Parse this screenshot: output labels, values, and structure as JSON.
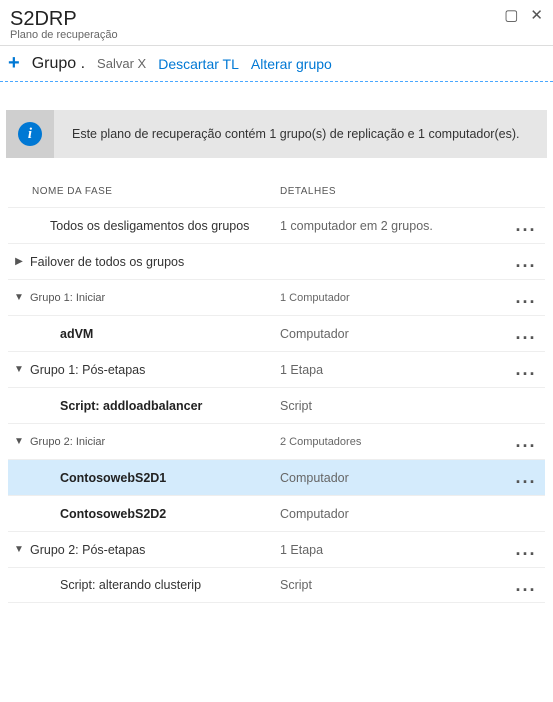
{
  "header": {
    "title": "S2DRP",
    "subtitle": "Plano de recuperação"
  },
  "toolbar": {
    "add_icon": "+",
    "group_label": "Grupo .",
    "save_label": "Salvar",
    "cancel_icon": "X",
    "discard_label": "Descartar TL",
    "change_group_label": "Alterar grupo"
  },
  "infobar": {
    "icon_letter": "i",
    "message": "Este plano de recuperação contém 1 grupo(s) de replicação e 1 computador(es)."
  },
  "columns": {
    "phase": "NOME DA FASE",
    "details": "DETALHES"
  },
  "rows": [
    {
      "arrow": "",
      "indent": "indent1",
      "bold": false,
      "tiny": false,
      "label": "Todos os desligamentos dos grupos",
      "detail": "1 computador em 2 grupos.",
      "dots": true,
      "selected": false
    },
    {
      "arrow": "▶",
      "indent": "",
      "bold": false,
      "tiny": false,
      "label": "Failover de todos os grupos",
      "detail": "",
      "dots": true,
      "selected": false
    },
    {
      "arrow": "▼",
      "indent": "",
      "bold": false,
      "tiny": true,
      "label": "Grupo 1: Iniciar",
      "detail": "1 Computador",
      "dots": true,
      "selected": false
    },
    {
      "arrow": "",
      "indent": "indent2",
      "bold": true,
      "tiny": false,
      "label": "adVM",
      "detail": "Computador",
      "dots": true,
      "selected": false
    },
    {
      "arrow": "▼",
      "indent": "",
      "bold": false,
      "tiny": false,
      "label": "Grupo 1: Pós-etapas",
      "detail": "1 Etapa",
      "dots": true,
      "selected": false
    },
    {
      "arrow": "",
      "indent": "indent2",
      "bold": true,
      "tiny": false,
      "label": "Script: addloadbalancer",
      "detail": "Script",
      "dots": false,
      "selected": false
    },
    {
      "arrow": "▼",
      "indent": "",
      "bold": false,
      "tiny": true,
      "label": "Grupo 2: Iniciar",
      "detail": "2 Computadores",
      "dots": true,
      "selected": false
    },
    {
      "arrow": "",
      "indent": "indent2",
      "bold": true,
      "tiny": false,
      "label": "ContosowebS2D1",
      "detail": "Computador",
      "dots": true,
      "selected": true
    },
    {
      "arrow": "",
      "indent": "indent2",
      "bold": true,
      "tiny": false,
      "label": "ContosowebS2D2",
      "detail": "Computador",
      "dots": false,
      "selected": false
    },
    {
      "arrow": "▼",
      "indent": "",
      "bold": false,
      "tiny": false,
      "label": "Grupo 2: Pós-etapas",
      "detail": "1 Etapa",
      "dots": true,
      "selected": false
    },
    {
      "arrow": "",
      "indent": "indent3",
      "bold": false,
      "tiny": false,
      "label": "Script: alterando clusterip",
      "detail": "Script",
      "dots": true,
      "selected": false
    }
  ]
}
